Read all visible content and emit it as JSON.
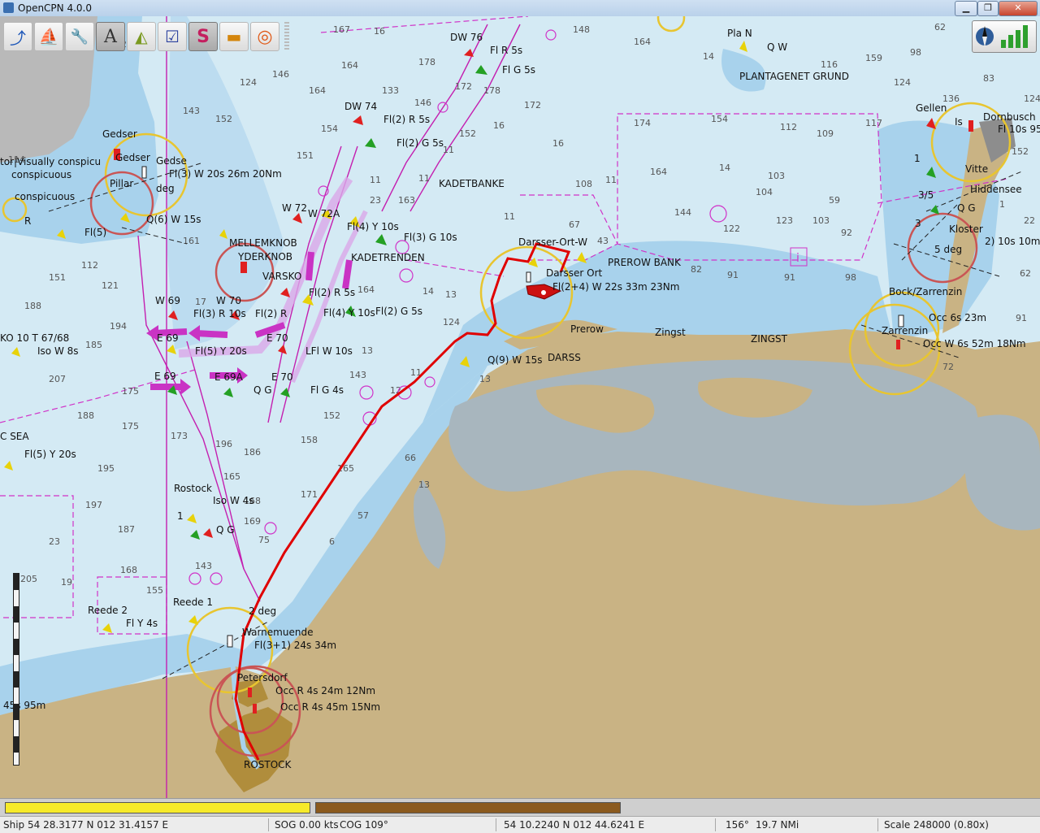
{
  "window": {
    "title": "OpenCPN 4.0.0",
    "minimize": "▁",
    "maximize": "❐",
    "close": "✕"
  },
  "toolbar": {
    "tools": [
      {
        "name": "route-icon",
        "glyph": "⤴",
        "color": "#1c56b8"
      },
      {
        "name": "ship-icon",
        "glyph": "⛵",
        "color": "#c62020"
      },
      {
        "name": "wrench-icon",
        "glyph": "🔧",
        "color": "#555555"
      },
      {
        "name": "text-icon",
        "glyph": "A",
        "color": "#333333"
      },
      {
        "name": "compass-icon",
        "glyph": "◭",
        "color": "#7a9a20"
      },
      {
        "name": "checklist-icon",
        "glyph": "☑",
        "color": "#2a3f9e"
      },
      {
        "name": "track-icon",
        "glyph": "S",
        "color": "#c41f5f"
      },
      {
        "name": "layers-icon",
        "glyph": "▬",
        "color": "#d4850c"
      },
      {
        "name": "lifebuoy-icon",
        "glyph": "◎",
        "color": "#e05a18"
      }
    ]
  },
  "colors": {
    "water_deep": "#d4eaf4",
    "water_shallow": "#a8d2ec",
    "water_very_shallow": "#7fb8dc",
    "land": "#c9b384",
    "town": "#b08d3c",
    "route": "#e00000",
    "magenta": "#d033c8",
    "beacon_yellow": "#f4e20c"
  },
  "chart_labels": {
    "dw76": "DW 76",
    "fl_r_5s_top": "Fl R 5s",
    "fl_g_5s_top": "Fl G 5s",
    "plan": "Pla N",
    "qw": "Q W",
    "plantagenet": "PLANTAGENET GRUND",
    "gedser": "Gedser",
    "gedser2": "Gedser",
    "gedser3": "Gedse",
    "tor_visually": "tor|Visually conspicu",
    "conspicuous": "conspicuous",
    "conspicuous2": "conspicuous",
    "fl3_w20s": "Fl(3) W 20s 26m 20Nm",
    "pillar": "Pillar",
    "deg_gedser": "deg",
    "qw15s": "Q(6) W 15s",
    "fl5": "Fl(5)",
    "dw74": "DW 74",
    "fl2r5s": "Fl(2) R 5s",
    "fl2g5s": "Fl(2) G 5s",
    "kadetbanke": "KADETBANKE",
    "w72": "W 72",
    "w72a": "W 72A",
    "fl4y10s": "Fl(4) Y 10s",
    "fl3g10s": "Fl(3) G 10s",
    "mellemknob": "MELLEMKNOB",
    "ydreknob": "YDERKNOB",
    "kadetrenden": "KADETRENDEN",
    "varsko": "VARSKO",
    "w69": "W 69",
    "w70": "W 70",
    "fl3r10s": "Fl(3) R 10s",
    "fl2r": "Fl(2) R",
    "fl2r5s_b": "Fl(2) R 5s",
    "fl10s": "Fl(4) Y 10s",
    "fl2g5s_b": "Fl(2) G 5s",
    "e69_top": "E 69",
    "e69a": "E 69A",
    "e69": "E 69",
    "e70": "E 70",
    "fl5y20s": "Fl(5) Y 20s",
    "lfl_w10s": "LFl W 10s",
    "fl_g_4s": "Fl G 4s",
    "qg_mid": "Q G",
    "ko10t": "KO 10 T 67/68",
    "iso_w8s": "Iso W 8s",
    "c_sea": "C SEA",
    "fl5y20s_left": "Fl(5) Y 20s",
    "darsser_ort": "Darsser-Ort-W",
    "darsser_ort2": "Darsser Ort",
    "prerow_bank": "PREROW BANK",
    "lfl2_4": "Fl(2+4) W 22s 33m 23Nm",
    "q9_w15s": "Q(9) W 15s",
    "darss": "DARSS",
    "prerow": "Prerow",
    "zingst_town": "Zingst",
    "zingst": "ZINGST",
    "gellen": "Gellen",
    "is": "Is",
    "dornbusch": "Dornbusch",
    "fl10s95": "Fl 10s 95",
    "vitte": "Vitte",
    "hiddensee": "Hiddensee",
    "qg_east": "Q G",
    "kloster": "Kloster",
    "deg_east": "5 deg",
    "fl2_10s": "2) 10s 10m",
    "one_east": "1",
    "three_five": "3/5",
    "three": "3",
    "bock": "Bock/Zarrenzin",
    "zarrenzin": "Zarrenzin",
    "occ6s23m": "Occ 6s 23m",
    "occw6s": "Occ W 6s 52m 18Nm",
    "rostock_buoy": "Rostock",
    "one_left": "1",
    "iso_w4s": "Iso W 4s",
    "qg_left": "Q G",
    "reede2": "Reede 2",
    "reede1": "Reede 1",
    "fly4s": "Fl Y 4s",
    "deg2": "2 deg",
    "warnemuende": "Warnemuende",
    "fl31": "Fl(3+1) 24s 34m",
    "petersdorf": "Petersdorf",
    "occr4s24": "Occ R 4s 24m 12Nm",
    "occr4s45": "Occ R 4s 45m 15Nm",
    "rostock": "ROSTOCK",
    "s45": "45s 95m",
    "r_left": "R"
  },
  "piano": {
    "key1_color": "#f6ea2a",
    "key2_color": "#8b5a1e"
  },
  "status": {
    "ship": "Ship 54 28.3177 N   012 31.4157 E",
    "sog": "SOG 0.00 kts",
    "cog": "COG 109°",
    "cursor": "54 10.2240 N   012 44.6241 E",
    "bearing": "156°",
    "distance": "19.7 NMi",
    "scale": "Scale 248000 (0.80x)"
  }
}
